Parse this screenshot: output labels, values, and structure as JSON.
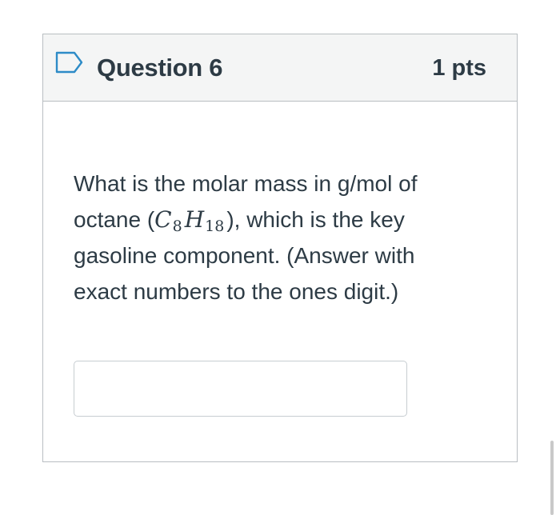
{
  "question": {
    "title": "Question 6",
    "points": "1 pts",
    "flag_icon": "flag-outline-icon",
    "text_before": "What is the molar mass in g/mol of octane (",
    "formula": {
      "c": "C",
      "c_sub": "8",
      "h": "H",
      "h_sub": "18"
    },
    "text_after": "), which is the key gasoline component.  (Answer with exact numbers to the ones digit.)"
  },
  "answer": {
    "value": "",
    "placeholder": ""
  },
  "colors": {
    "header_bg": "#f4f5f5",
    "border": "#b9bec2",
    "text": "#2d3b45",
    "flag": "#2d8bc7"
  }
}
